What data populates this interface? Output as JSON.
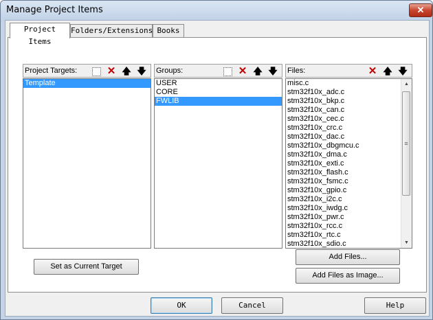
{
  "window": {
    "title": "Manage Project Items",
    "close_glyph": "✕"
  },
  "tabs": [
    {
      "label": "Project Items",
      "active": true
    },
    {
      "label": "Folders/Extensions",
      "active": false
    },
    {
      "label": "Books",
      "active": false
    }
  ],
  "targets": {
    "label": "Project Targets:",
    "items": [
      "Template"
    ],
    "selected": "Template"
  },
  "groups": {
    "label": "Groups:",
    "items": [
      "USER",
      "CORE",
      "FWLIB"
    ],
    "selected": "FWLIB"
  },
  "files": {
    "label": "Files:",
    "items": [
      "misc.c",
      "stm32f10x_adc.c",
      "stm32f10x_bkp.c",
      "stm32f10x_can.c",
      "stm32f10x_cec.c",
      "stm32f10x_crc.c",
      "stm32f10x_dac.c",
      "stm32f10x_dbgmcu.c",
      "stm32f10x_dma.c",
      "stm32f10x_exti.c",
      "stm32f10x_flash.c",
      "stm32f10x_fsmc.c",
      "stm32f10x_gpio.c",
      "stm32f10x_i2c.c",
      "stm32f10x_iwdg.c",
      "stm32f10x_pwr.c",
      "stm32f10x_rcc.c",
      "stm32f10x_rtc.c",
      "stm32f10x_sdio.c"
    ]
  },
  "toolbar": {
    "new_icon": "new-item-icon",
    "delete_glyph": "✕",
    "up_glyph": "🡅",
    "down_glyph": "🡇"
  },
  "buttons": {
    "set_current": "Set as Current Target",
    "add_files": "Add Files...",
    "add_files_image": "Add Files as Image...",
    "ok": "OK",
    "cancel": "Cancel",
    "help": "Help"
  },
  "colors": {
    "selection": "#3399ff",
    "delete": "#c00000"
  }
}
